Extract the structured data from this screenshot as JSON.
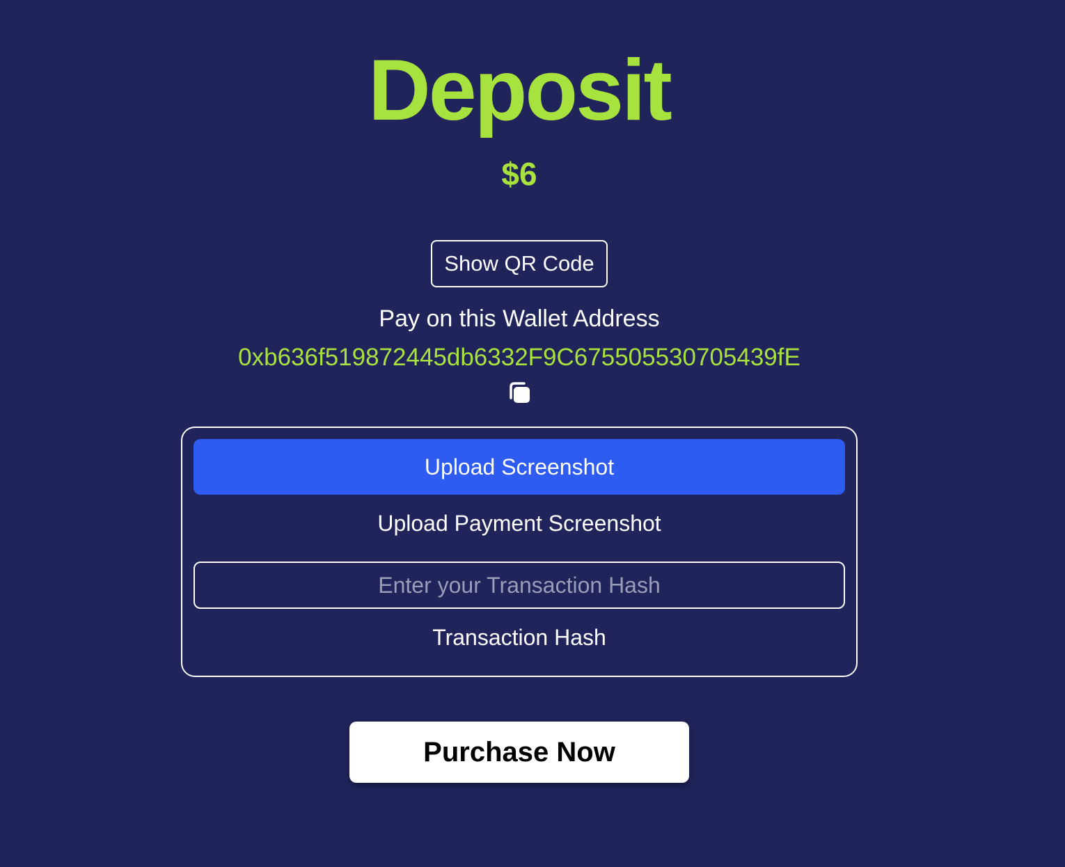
{
  "header": {
    "title": "Deposit",
    "amount": "$6"
  },
  "qr": {
    "button_label": "Show QR Code"
  },
  "wallet": {
    "label": "Pay on this Wallet Address",
    "address": "0xb636f519872445db6332F9C675505530705439fE",
    "copy_icon": "copy-icon"
  },
  "upload": {
    "button_label": "Upload Screenshot",
    "caption": "Upload Payment Screenshot"
  },
  "transaction": {
    "placeholder": "Enter your Transaction Hash",
    "value": "",
    "caption": "Transaction Hash"
  },
  "purchase": {
    "button_label": "Purchase Now"
  },
  "colors": {
    "background": "#20245a",
    "accent": "#a8e23e",
    "primary_button": "#2e5bf0"
  }
}
